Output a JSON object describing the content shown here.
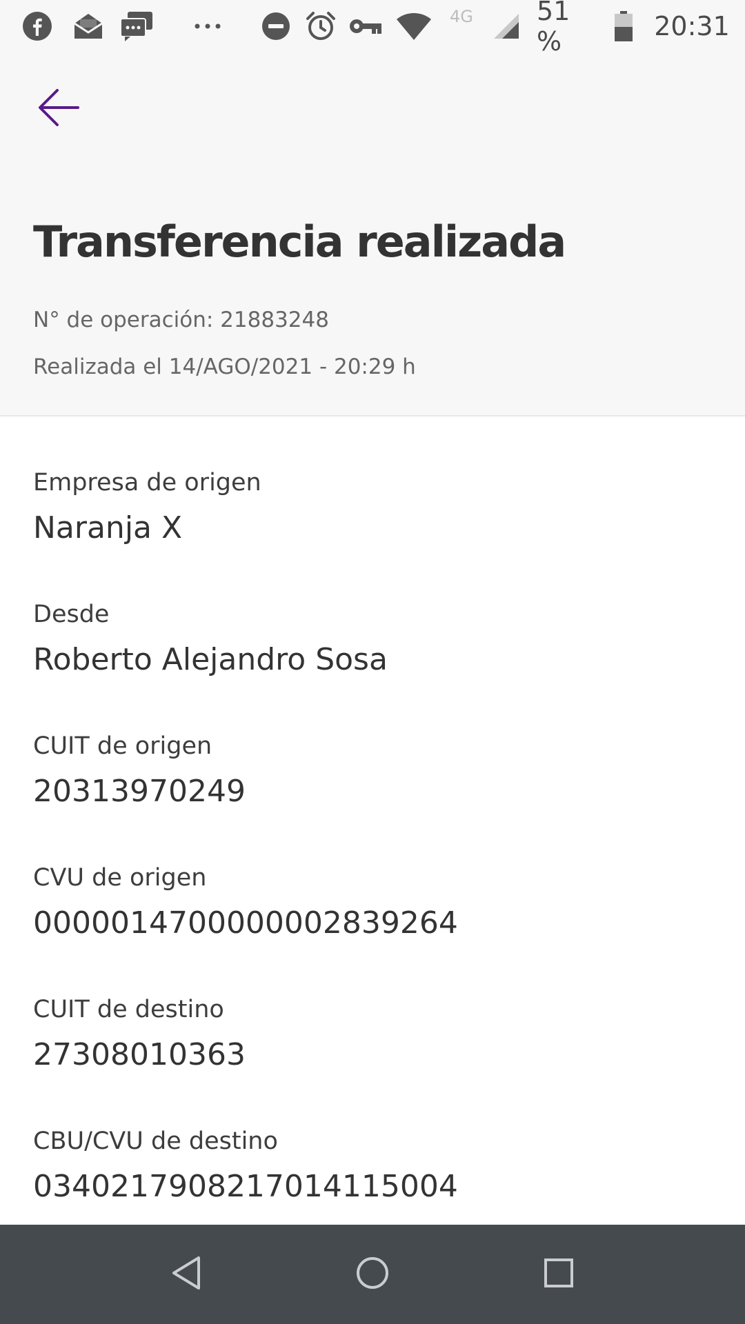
{
  "status_bar": {
    "network_label": "4G",
    "battery_text": "51 %",
    "time": "20:31",
    "notifications": [
      "facebook-icon",
      "mail-icon",
      "messages-icon",
      "more-notifications-icon"
    ],
    "system": [
      "do-not-disturb-icon",
      "alarm-icon",
      "vpn-key-icon",
      "wifi-icon",
      "signal-icon",
      "battery-icon"
    ]
  },
  "header": {
    "back_icon": "arrow-left-icon",
    "title": "Transferencia realizada",
    "operation_number": "N° de operación: 21883248",
    "date": "Realizada el 14/AGO/2021 - 20:29 h"
  },
  "details": [
    {
      "label": "Empresa de origen",
      "value": "Naranja X"
    },
    {
      "label": "Desde",
      "value": "Roberto Alejandro Sosa"
    },
    {
      "label": "CUIT de origen",
      "value": "20313970249"
    },
    {
      "label": "CVU de origen",
      "value": "0000014700000002839264"
    },
    {
      "label": "CUIT de destino",
      "value": "27308010363"
    },
    {
      "label": "CBU/CVU de destino",
      "value": "0340217908217014115004"
    }
  ],
  "nav_bar": {
    "buttons": [
      "nav-back-icon",
      "nav-home-icon",
      "nav-recents-icon"
    ]
  },
  "colors": {
    "accent": "#5a1a8a",
    "header_bg": "#f7f7f7",
    "nav_bg": "#454a4f",
    "text": "#333333"
  }
}
